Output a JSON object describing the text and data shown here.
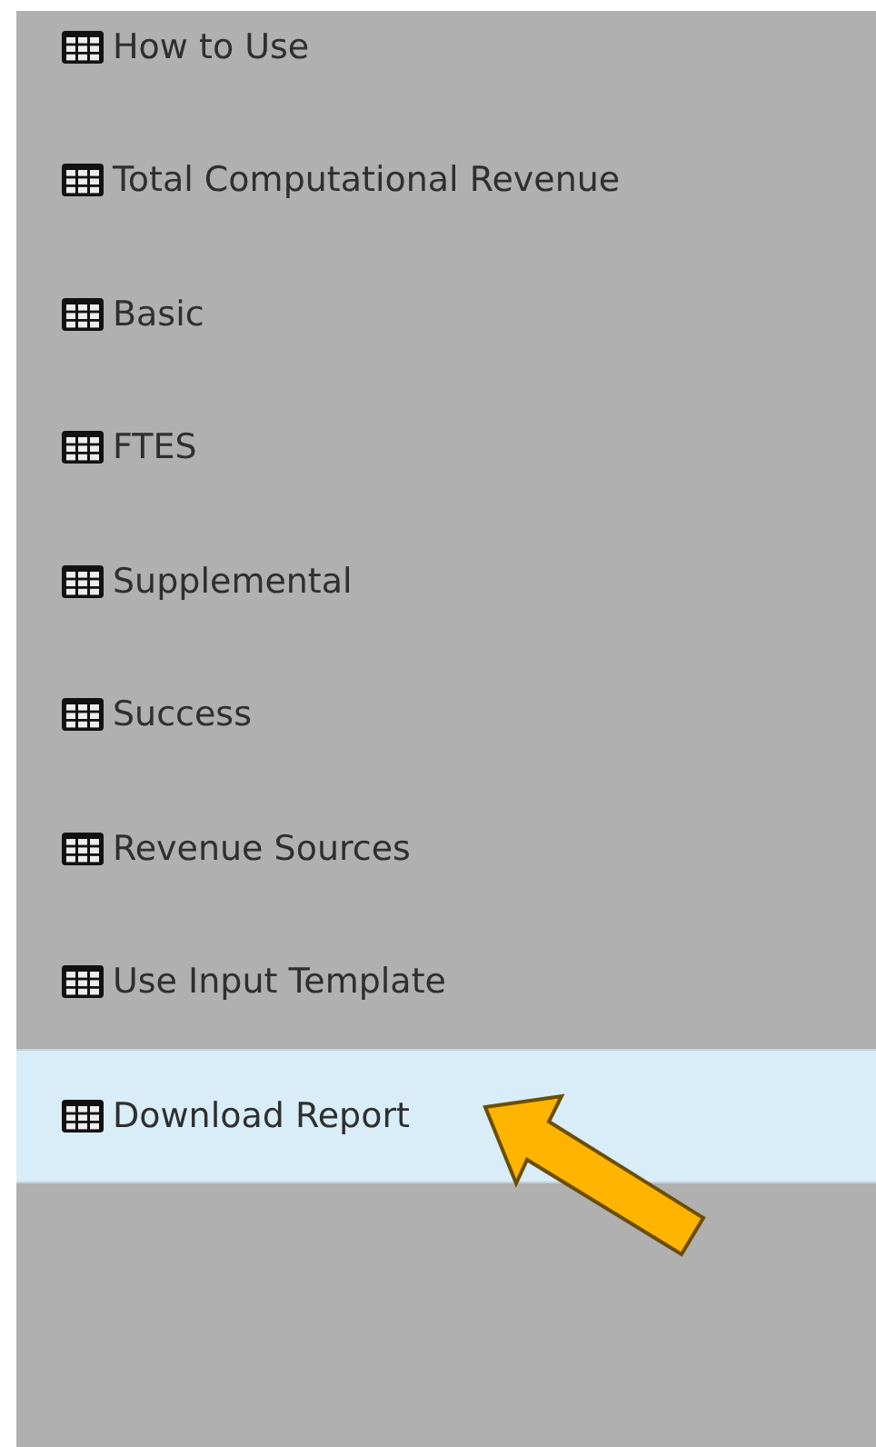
{
  "sidebar": {
    "items": [
      {
        "label": "How to Use",
        "selected": false
      },
      {
        "label": "Total Computational Revenue",
        "selected": false
      },
      {
        "label": "Basic",
        "selected": false
      },
      {
        "label": "FTES",
        "selected": false
      },
      {
        "label": "Supplemental",
        "selected": false
      },
      {
        "label": "Success",
        "selected": false
      },
      {
        "label": "Revenue Sources",
        "selected": false
      },
      {
        "label": "Use Input Template",
        "selected": false
      },
      {
        "label": "Download Report",
        "selected": true
      }
    ]
  }
}
